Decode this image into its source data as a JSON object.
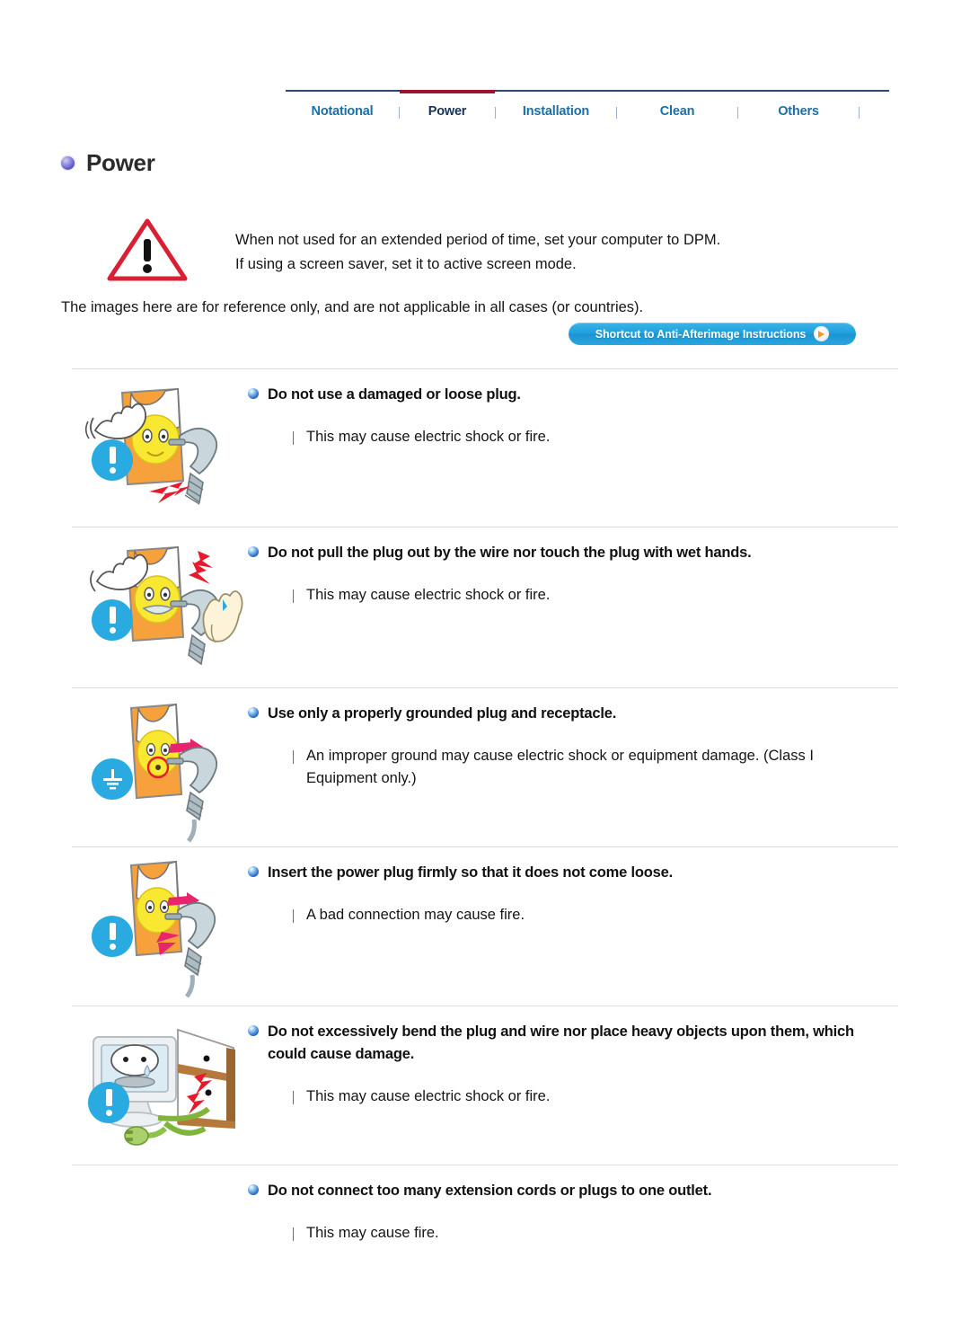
{
  "nav": {
    "tabs": [
      {
        "label": "Notational",
        "active": false
      },
      {
        "label": "Power",
        "active": true
      },
      {
        "label": "Installation",
        "active": false
      },
      {
        "label": "Clean",
        "active": false
      },
      {
        "label": "Others",
        "active": false
      }
    ],
    "active_color": "#9c1230",
    "link_color": "#1a6fa8",
    "active_text_color": "#16325c"
  },
  "page": {
    "title": "Power"
  },
  "warning": {
    "icon": "warning-triangle-icon",
    "line1": "When not used for an extended period of time, set your computer to DPM.",
    "line2": "If using a screen saver, set it to active screen mode."
  },
  "reference_note": "The images here are for reference only, and are not applicable in all cases (or countries).",
  "shortcut": {
    "label": "Shortcut to Anti-Afterimage Instructions",
    "icon": "play-arrow-icon",
    "bg_color": "#1f9fdc",
    "arrow_color": "#f7941e"
  },
  "sections": [
    {
      "heading": "Do not use a damaged or loose plug.",
      "sub": "This may cause electric shock or fire.",
      "badge": "exclamation-badge-icon",
      "badge_color": "#29abe2",
      "art": "damaged-loose-plug-illustration"
    },
    {
      "heading": "Do not pull the plug out by the wire nor touch the plug with wet hands.",
      "sub": "This may cause electric shock or fire.",
      "badge": "exclamation-badge-icon",
      "badge_color": "#29abe2",
      "art": "wet-hands-plug-illustration"
    },
    {
      "heading": "Use only a properly grounded plug and receptacle.",
      "sub": "An improper ground may cause electric shock or equipment damage. (Class I Equipment only.)",
      "badge": "ground-earth-badge-icon",
      "badge_color": "#29abe2",
      "art": "grounded-plug-illustration"
    },
    {
      "heading": "Insert the power plug firmly so that it does not come loose.",
      "sub": "A bad connection may cause fire.",
      "badge": "exclamation-badge-icon",
      "badge_color": "#29abe2",
      "art": "insert-plug-firmly-illustration"
    },
    {
      "heading": "Do not excessively bend the plug and wire nor place heavy objects upon them, which could cause damage.",
      "sub": "This may cause electric shock or fire.",
      "badge": "exclamation-badge-icon",
      "badge_color": "#29abe2",
      "art": "bent-wire-monitor-illustration"
    },
    {
      "heading": "Do not connect too many extension cords or plugs to one outlet.",
      "sub": "This may cause fire.",
      "badge": "exclamation-badge-icon",
      "badge_color": "#29abe2",
      "art": "extension-cords-illustration"
    }
  ]
}
